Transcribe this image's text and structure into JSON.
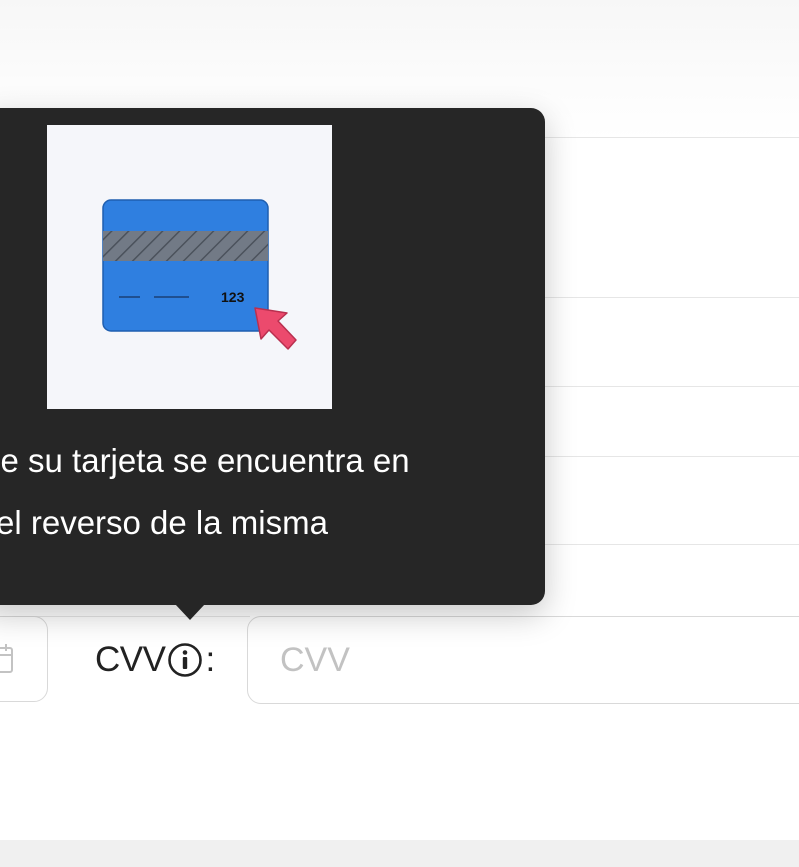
{
  "tooltip": {
    "line1": "se su tarjeta se encuentra en",
    "line2": "el reverso de la misma",
    "image": {
      "card_number_text": "123",
      "card_color": "#2f7fe0",
      "stripe_color": "#727a86",
      "cursor_color": "#ec4a6d"
    },
    "background": "#262626"
  },
  "form": {
    "cvv_label": "CVV",
    "cvv_colon": ":",
    "cvv_placeholder": "CVV",
    "cvv_value": ""
  },
  "icons": {
    "info": "info-circle-icon",
    "calendar": "calendar-icon",
    "cursor": "cursor-pointer-icon"
  }
}
